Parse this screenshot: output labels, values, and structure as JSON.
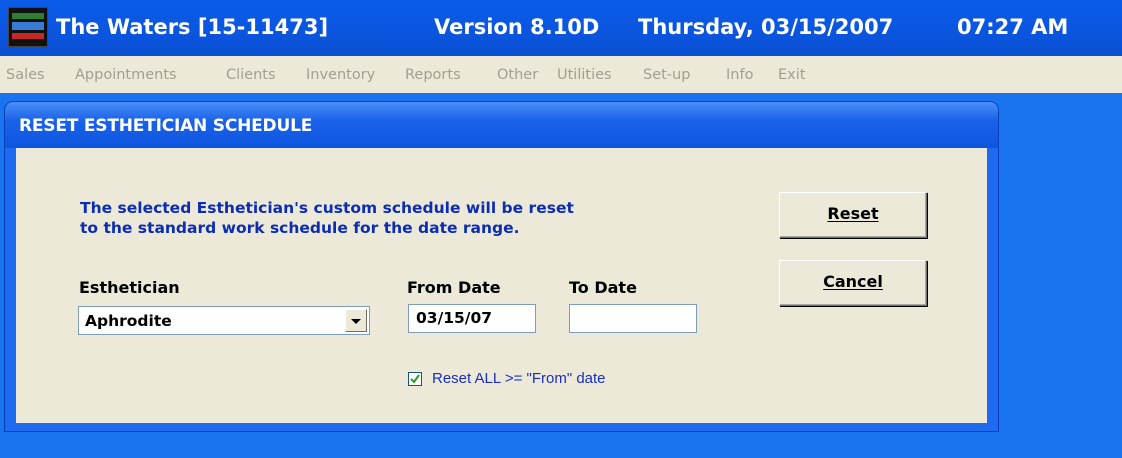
{
  "titlebar": {
    "app": "The Waters [15-11473]",
    "version": "Version 8.10D",
    "date": "Thursday, 03/15/2007",
    "time": "07:27 AM",
    "icon": "app-icon"
  },
  "menu": {
    "items": [
      "Sales",
      "Appointments",
      "Clients",
      "Inventory",
      "Reports",
      "Other",
      "Utilities",
      "Set-up",
      "Info",
      "Exit"
    ]
  },
  "dialog": {
    "title": "RESET ESTHETICIAN SCHEDULE",
    "instructions": [
      "The selected Esthetician's custom schedule will be reset",
      "to the standard work schedule for the date range."
    ],
    "esthetician_label": "Esthetician",
    "esthetician_value": "Aphrodite",
    "from_label": "From Date",
    "from_value": "03/15/07",
    "to_label": "To Date",
    "to_value": "",
    "checkbox_label": "Reset ALL >= \"From\" date",
    "checkbox_checked": true,
    "reset_button": "Reset",
    "cancel_button": "Cancel"
  },
  "colors": {
    "desktop": "#1a73ef",
    "instructions_text": "#0b2db4",
    "menu_disabled": "#a29f92"
  }
}
